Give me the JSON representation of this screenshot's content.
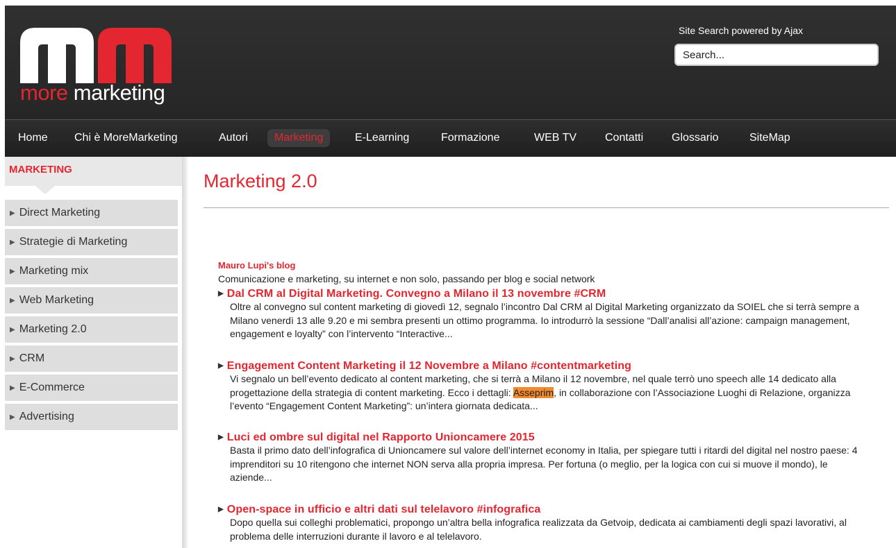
{
  "header": {
    "logo_more": "more",
    "logo_marketing": "marketing",
    "search_label": "Site Search powered by Ajax",
    "search_placeholder": "Search...",
    "brand_red": "#e3262f"
  },
  "nav": {
    "items": [
      {
        "label": "Home"
      },
      {
        "label": "Chi è MoreMarketing"
      },
      {
        "label": "Autori"
      },
      {
        "label": "Marketing",
        "active": true
      },
      {
        "label": "E-Learning"
      },
      {
        "label": "Formazione"
      },
      {
        "label": "WEB TV"
      },
      {
        "label": "Contatti"
      },
      {
        "label": "Glossario"
      },
      {
        "label": "SiteMap"
      }
    ]
  },
  "sidebar": {
    "heading": "MARKETING",
    "items": [
      {
        "label": "Direct Marketing"
      },
      {
        "label": "Strategie di Marketing"
      },
      {
        "label": "Marketing mix"
      },
      {
        "label": "Web Marketing"
      },
      {
        "label": "Marketing 2.0"
      },
      {
        "label": "CRM"
      },
      {
        "label": "E-Commerce"
      },
      {
        "label": "Advertising"
      }
    ]
  },
  "main": {
    "page_title": "Marketing 2.0",
    "blog_name": "Mauro Lupi's blog",
    "blog_desc": "Comunicazione e marketing, su internet e non solo, passando per blog e social network",
    "posts": [
      {
        "title": "Dal CRM al Digital Marketing. Convegno a Milano il 13 novembre #CRM",
        "excerpt": "Oltre al convegno sul content marketing di giovedì 12, segnalo l’incontro Dal CRM al Digital Marketing organizzato da SOIEL che si terrà sempre a Milano venerdì 13 alle 9.20 e mi sembra presenti un ottimo programma. Io introdurrò la sessione “Dall’analisi all’azione: campaign management, engagement e loyalty” con l’intervento “Interactive..."
      },
      {
        "title": "Engagement Content Marketing il 12 Novembre a Milano #contentmarketing",
        "excerpt_before": "Vi segnalo un bell’evento dedicato al content marketing, che si terrà a Milano il 12 novembre, nel quale terrò uno speech alle 14 dedicato alla progettazione della strategia di content marketing. Ecco i dettagli: ",
        "excerpt_highlight": "Asseprim",
        "excerpt_after": ", in collaborazione con l’Associazione Luoghi di Relazione, organizza l’evento “Engagement Content Marketing”: un’intera giornata dedicata..."
      },
      {
        "title": "Luci ed ombre sul digital nel Rapporto Unioncamere 2015",
        "excerpt": "Basta il primo dato dell’infografica di Unioncamere sul valore dell’internet economy in Italia, per spiegare tutti i ritardi del digital nel nostro paese: 4 imprenditori su 10 ritengono che internet NON serva alla propria impresa. Per fortuna (o meglio, per la logica con cui si muove il mondo), le aziende..."
      },
      {
        "title": "Open-space in ufficio e altri dati sul telelavoro #infografica",
        "excerpt": "Dopo quella sui colleghi problematici, propongo un’altra bella infografica realizzata da Getvoip, dedicata ai cambiamenti degli spazi lavorativi, al problema delle interruzioni durante il lavoro e al telelavoro."
      }
    ]
  }
}
